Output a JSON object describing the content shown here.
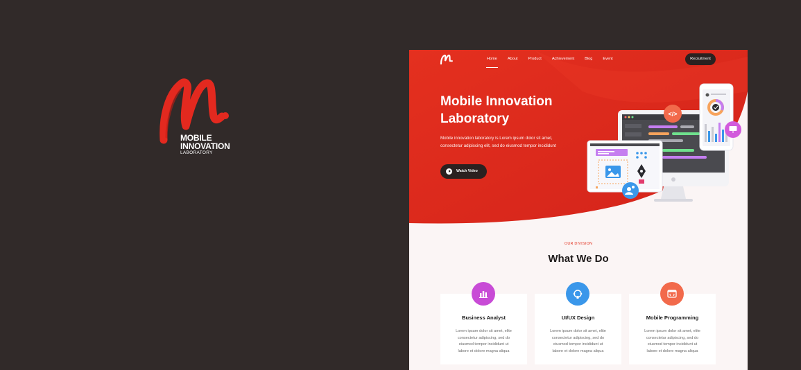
{
  "brand": {
    "line1": "MOBILE",
    "line2": "INNOVATION",
    "line3": "LABORATORY",
    "accent_color": "#e3291f"
  },
  "nav": {
    "logo_icon": "m-script-logo-icon",
    "links": [
      "Home",
      "About",
      "Product",
      "Achievement",
      "Blog",
      "Event"
    ],
    "active": "Home",
    "cta_label": "Recruitment"
  },
  "hero": {
    "title_line1": "Mobile Innovation",
    "title_line2": "Laboratory",
    "subtitle_line1": "Mobile innovation laboratory is Lorem ipsum dolor sit amet,",
    "subtitle_line2": "consectetur adipiscing elit, sed do eiusmod tempor incididunt",
    "watch_label": "Watch Video",
    "watch_icon": "play-icon",
    "illustration_code_badge": "</>",
    "bg_color": "#e0261b"
  },
  "division": {
    "kicker": "OUR DIVISION",
    "title": "What We Do",
    "cards": [
      {
        "icon": "bar-chart-icon",
        "icon_color": "#c84bd6",
        "title": "Business Analyst",
        "lines": [
          "Lorem ipsum dolor sit amet, elite",
          "consectetur adipiscing, sed do",
          "eiusmod tempor incididunt ut",
          "labore et dolore magna aliqua"
        ]
      },
      {
        "icon": "design-pen-icon",
        "icon_color": "#3a97ea",
        "title": "UI/UX Design",
        "lines": [
          "Lorem ipsum dolor sit amet, elite",
          "consectetur adipiscing, sed do",
          "eiusmod tempor incididunt ut",
          "labore et dolore magna aliqua"
        ]
      },
      {
        "icon": "code-window-icon",
        "icon_color": "#f26a4b",
        "title": "Mobile Programming",
        "lines": [
          "Lorem ipsum dolor sit amet, elite",
          "consectetur adipiscing, sed do",
          "eiusmod tempor incididunt ut",
          "labore et dolore magna aliqua"
        ]
      }
    ]
  }
}
